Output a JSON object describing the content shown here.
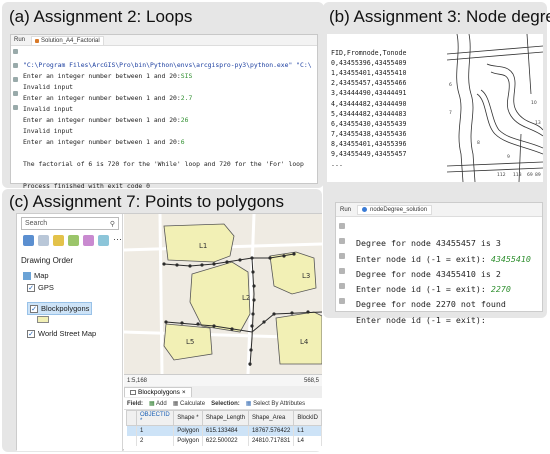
{
  "panels": {
    "a": {
      "title": "(a) Assignment 2: Loops",
      "run_label": "Run",
      "tab_label": "Solution_A4_Factorial",
      "lines": [
        {
          "text": "\"C:\\Program Files\\ArcGIS\\Pro\\bin\\Python\\envs\\arcgispro-py3\\python.exe\" \"C:\\",
          "input": ""
        },
        {
          "text": "Enter an integer number between 1 and 20:",
          "input": "SIS"
        },
        {
          "text": "Invalid input",
          "input": ""
        },
        {
          "text": "Enter an integer number between 1 and 20:",
          "input": "2.7"
        },
        {
          "text": "Invalid input",
          "input": ""
        },
        {
          "text": "Enter an integer number between 1 and 20:",
          "input": "26"
        },
        {
          "text": "Invalid input",
          "input": ""
        },
        {
          "text": "Enter an integer number between 1 and 20:",
          "input": "6"
        },
        {
          "text": "",
          "input": ""
        },
        {
          "text": "The factorial of 6 is 720 for the 'While' loop and 720 for the 'For' loop",
          "input": ""
        },
        {
          "text": "",
          "input": ""
        },
        {
          "text": "Process finished with exit code 0",
          "input": ""
        }
      ]
    },
    "b": {
      "title": "(b) Assignment 3: Node degree",
      "csv_lines": [
        "FID,Fromnode,Tonode",
        "0,43455396,43455409",
        "1,43455401,43455410",
        "2,43455457,43455466",
        "3,43444490,43444491",
        "4,43444482,43444490",
        "5,43444482,43444483",
        "6,43455430,43455439",
        "7,43455438,43455436",
        "8,43455401,43455396",
        "9,43455449,43455457",
        "..."
      ],
      "run_label": "Run",
      "tab_label": "nodeDegree_solution",
      "map_labels": [
        "6",
        "7",
        "8",
        "9",
        "10",
        "13",
        "112",
        "113",
        "69",
        "89"
      ],
      "console": [
        {
          "text": "Degree for node 43455457 is 3",
          "input": ""
        },
        {
          "text": "Enter node id (-1 = exit): ",
          "input": "43455410"
        },
        {
          "text": "Degree for node 43455410 is 2",
          "input": ""
        },
        {
          "text": "Enter node id (-1 = exit): ",
          "input": "2270"
        },
        {
          "text": "Degree for node 2270 not found",
          "input": ""
        },
        {
          "text": "Enter node id (-1 = exit):",
          "input": ""
        }
      ]
    },
    "c": {
      "title": "(c) Assignment 7: Points to polygons",
      "search_placeholder": "Search",
      "drawing_order": "Drawing Order",
      "layers": {
        "map": "Map",
        "gps": "GPS",
        "blockpolygons": "Blockpolygons",
        "world_street_map": "World Street Map"
      },
      "polygon_labels": [
        "L1",
        "L2",
        "L3",
        "L4",
        "L5"
      ],
      "scale": "1:5,168",
      "coord": "568,5",
      "attr_tab": "Blockpolygons",
      "attr_toolbar": {
        "field": "Field:",
        "add": "Add",
        "calculate": "Calculate",
        "selection": "Selection:",
        "select_by_attr": "Select By Attributes"
      },
      "table": {
        "headers": [
          "OBJECTID *",
          "Shape *",
          "Shape_Length",
          "Shape_Area",
          "BlockID"
        ],
        "rows": [
          [
            "1",
            "Polygon",
            "615.133484",
            "18767.576422",
            "L1"
          ],
          [
            "2",
            "Polygon",
            "622.500022",
            "24810.717831",
            "L4"
          ]
        ]
      }
    }
  },
  "colors": {
    "panel_bg": "#e6e6e6",
    "polygon_fill": "#f2f0b5",
    "user_input_green": "#2f8f2f",
    "path_blue": "#1c3fa0"
  }
}
